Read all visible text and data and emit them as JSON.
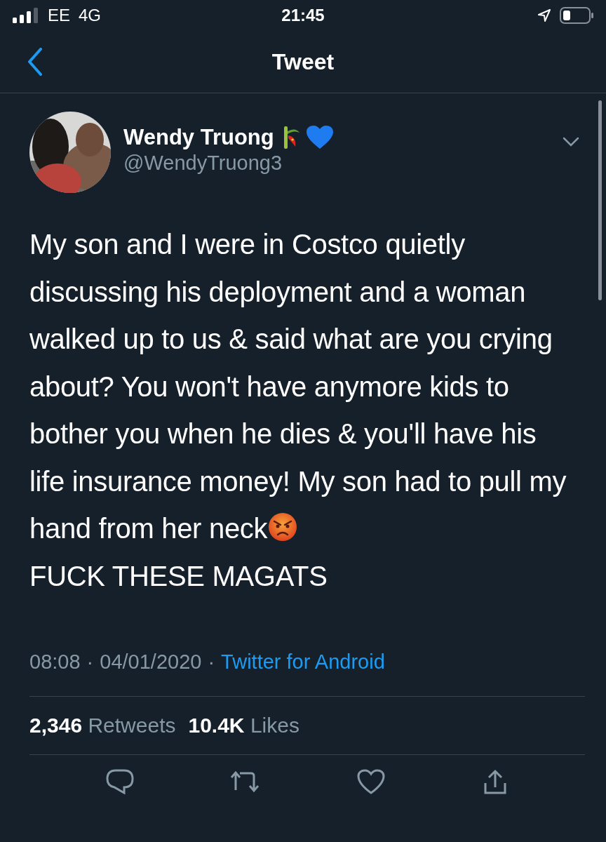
{
  "status_bar": {
    "carrier": "EE",
    "network": "4G",
    "time": "21:45"
  },
  "header": {
    "title": "Tweet"
  },
  "tweet": {
    "name": "Wendy Truong",
    "handle": "@WendyTruong3",
    "body": [
      "My son and I were in Costco quietly discussing his deployment and a woman walked up to us & said what are you crying about? You won't have anymore kids to bother you when he dies & you'll have his life insurance money! My son had to pull my hand from her neck",
      "FUCK THESE MAGATS"
    ],
    "time": "08:08",
    "date": "04/01/2020",
    "separators": [
      "·",
      "·"
    ],
    "source": "Twitter for Android",
    "stats": [
      {
        "count": "2,346",
        "label": "Retweets"
      },
      {
        "count": "10.4K",
        "label": "Likes"
      }
    ]
  }
}
